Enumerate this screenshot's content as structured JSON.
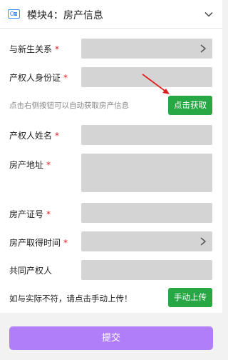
{
  "header": {
    "title": "模块4：房产信息",
    "icon": "id-card-icon",
    "accent": "#3a8ef6"
  },
  "fields": {
    "relation_label": "与新生关系",
    "owner_id_label": "产权人身份证",
    "owner_name_label": "产权人姓名",
    "address_label": "房产地址",
    "cert_no_label": "房产证号",
    "acquire_time_label": "房产取得时间",
    "co_owner_label": "共同产权人",
    "required_mark": "*"
  },
  "auto_fetch": {
    "hint": "点击右侧按钮可以自动获取房产信息",
    "button": "点击获取"
  },
  "manual": {
    "hint": "如与实际不符，请点击手动上传！",
    "button": "手动上传"
  },
  "submit": {
    "label": "提交"
  },
  "colors": {
    "green": "#27a844",
    "purple": "#b07ef8",
    "required": "#e02020",
    "field": "#d4d4d4"
  }
}
